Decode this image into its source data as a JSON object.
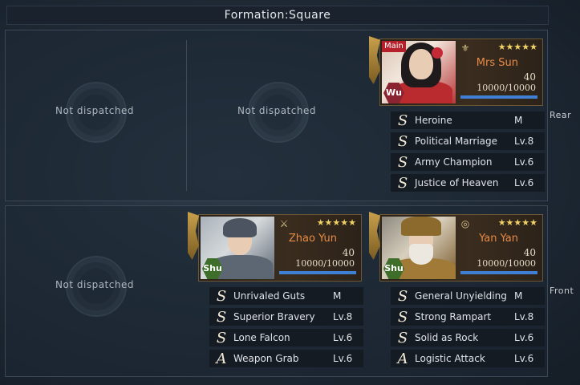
{
  "formation": {
    "title": "Formation:Square"
  },
  "rows": {
    "rear_label": "Rear",
    "front_label": "Front"
  },
  "empty_slot_text": "Not dispatched",
  "generals": {
    "sun": {
      "name": "Mrs Sun",
      "badge": "Main",
      "faction": "Wu",
      "level": "40",
      "troops": "10000/10000",
      "troop_fraction": 1.0,
      "stars": "★★★★★",
      "skills": [
        {
          "grade": "S",
          "name": "Heroine",
          "lv": "M"
        },
        {
          "grade": "S",
          "name": "Political Marriage",
          "lv": "Lv.8"
        },
        {
          "grade": "S",
          "name": "Army Champion",
          "lv": "Lv.6"
        },
        {
          "grade": "S",
          "name": "Justice of Heaven",
          "lv": "Lv.6"
        }
      ]
    },
    "zhao": {
      "name": "Zhao Yun",
      "faction": "Shu",
      "level": "40",
      "troops": "10000/10000",
      "troop_fraction": 1.0,
      "stars": "★★★★★",
      "skills": [
        {
          "grade": "S",
          "name": "Unrivaled Guts",
          "lv": "M"
        },
        {
          "grade": "S",
          "name": "Superior Bravery",
          "lv": "Lv.8"
        },
        {
          "grade": "S",
          "name": "Lone Falcon",
          "lv": "Lv.6"
        },
        {
          "grade": "A",
          "name": "Weapon Grab",
          "lv": "Lv.6"
        }
      ]
    },
    "yan": {
      "name": "Yan Yan",
      "faction": "Shu",
      "level": "40",
      "troops": "10000/10000",
      "troop_fraction": 1.0,
      "stars": "★★★★★",
      "skills": [
        {
          "grade": "S",
          "name": "General Unyielding",
          "lv": "M"
        },
        {
          "grade": "S",
          "name": "Strong Rampart",
          "lv": "Lv.8"
        },
        {
          "grade": "S",
          "name": "Solid as Rock",
          "lv": "Lv.6"
        },
        {
          "grade": "A",
          "name": "Logistic Attack",
          "lv": "Lv.6"
        }
      ]
    }
  },
  "colors": {
    "troop_bar": "#3f7fd4",
    "name": "#e98a46",
    "stars": "#f1d267"
  }
}
